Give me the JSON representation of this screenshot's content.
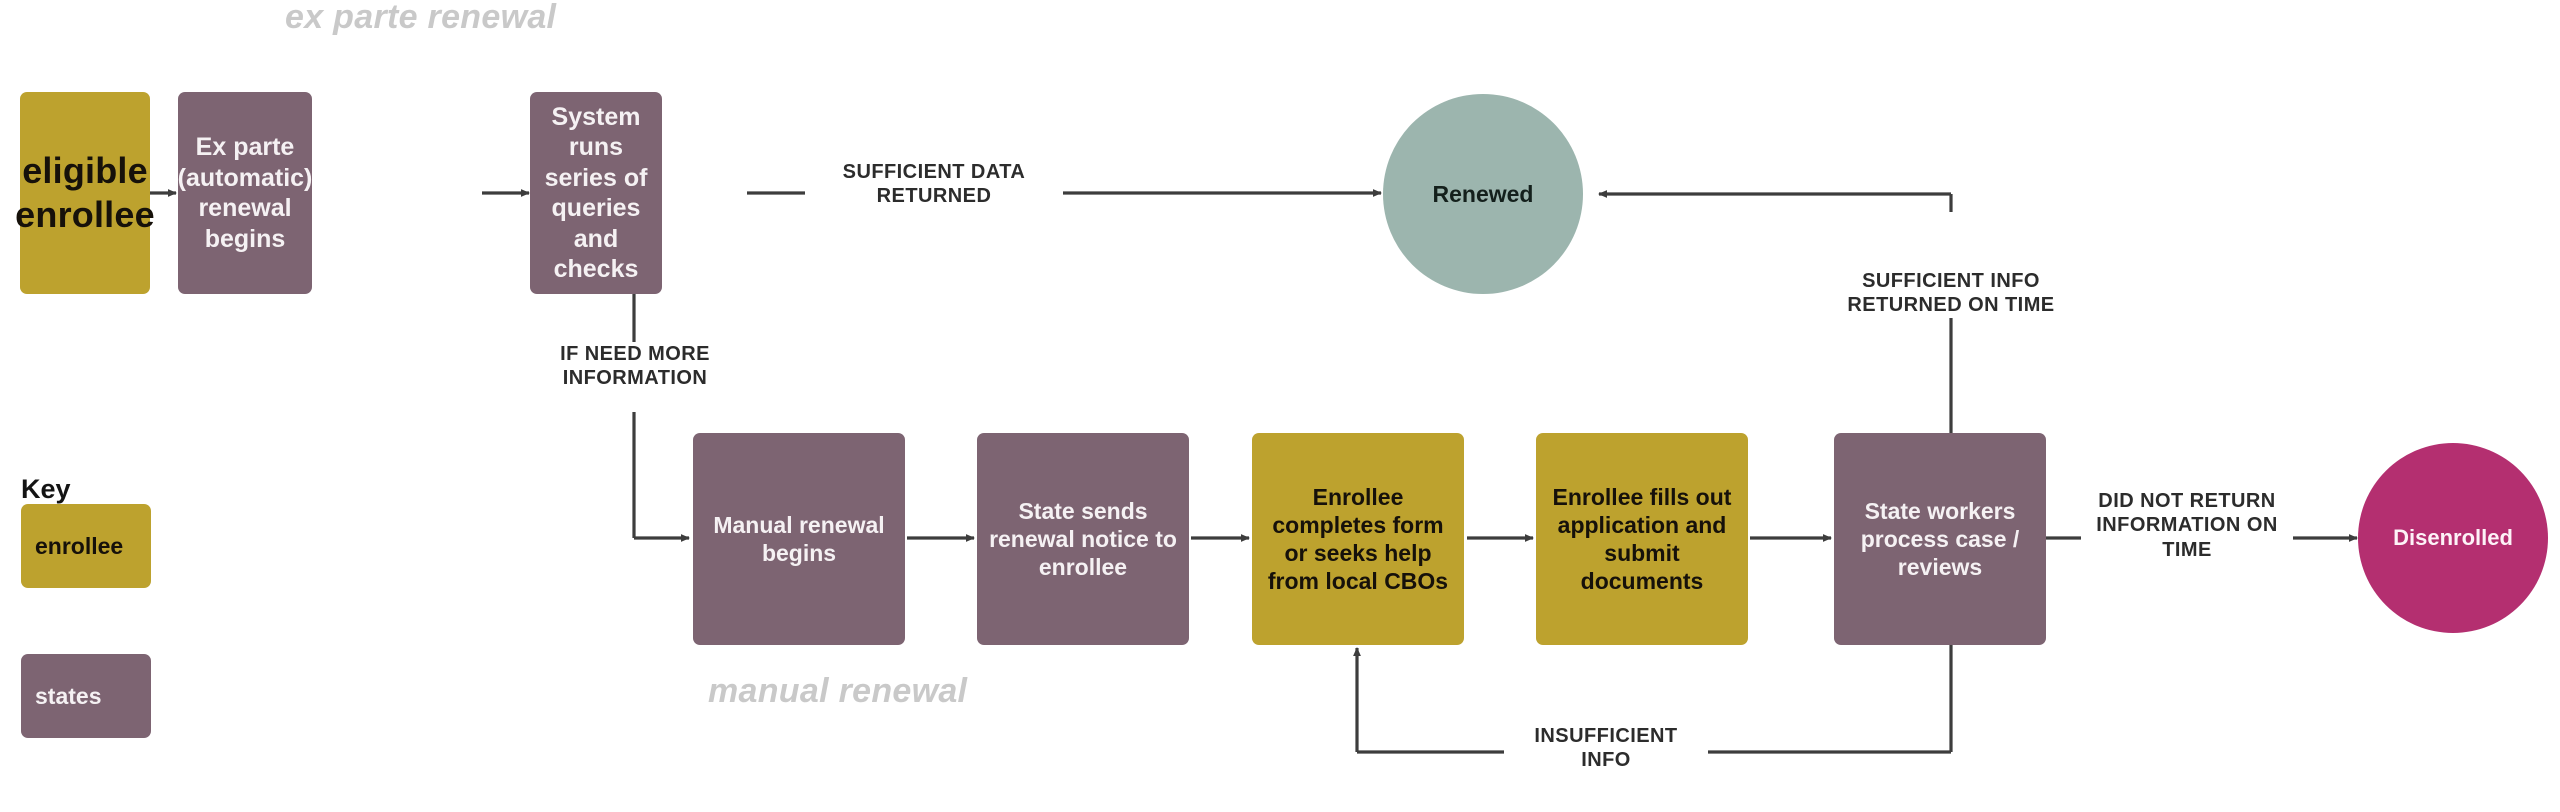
{
  "diagram": {
    "title_bands": [
      {
        "id": "ex-parte",
        "label": "ex parte renewal"
      },
      {
        "id": "manual",
        "label": "manual renewal"
      }
    ],
    "nodes": {
      "eligible_enrollee": "eligible\nenrollee",
      "eligible_enrollee_line1": "eligible",
      "eligible_enrollee_line2": "enrollee",
      "ex_parte_begins": "Ex parte (automatic) renewal begins",
      "system_runs": "System runs series of queries and checks",
      "renewed": "Renewed",
      "manual_begins": "Manual renewal begins",
      "state_sends_notice": "State sends renewal notice to enrollee",
      "enrollee_completes": "Enrollee completes form or seeks help from local CBOs",
      "enrollee_fills": "Enrollee fills out application and submit documents",
      "state_workers": "State workers process case / reviews",
      "disenrolled": "Disenrolled"
    },
    "edge_labels": {
      "sufficient_data_returned": "SUFFICIENT DATA RETURNED",
      "if_need_more_information": "IF NEED MORE INFORMATION",
      "sufficient_info_returned_on_time": "SUFFICIENT INFO RETURNED ON TIME",
      "did_not_return_information_on_time": "DID NOT RETURN INFORMATION ON TIME",
      "insufficient_info": "INSUFFICIENT INFO"
    },
    "key": {
      "title": "Key",
      "items": [
        {
          "label": "enrollee",
          "color": "#bda22e"
        },
        {
          "label": "states",
          "color": "#7d6472"
        }
      ]
    },
    "colors": {
      "enrollee": "#bda22e",
      "states": "#7d6472",
      "renewed": "#9cb5ae",
      "disenrolled": "#b42f70",
      "band_label": "#c9c9c9",
      "edge": "#3d3d3d",
      "background": "#ffffff"
    }
  }
}
